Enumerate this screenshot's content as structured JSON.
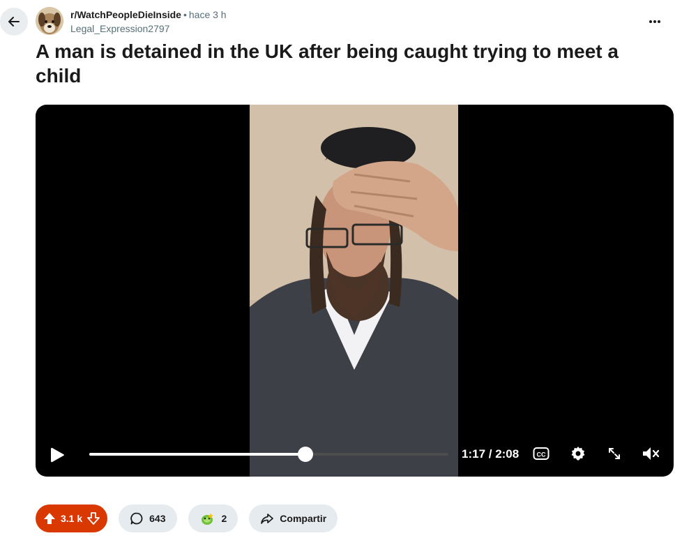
{
  "post": {
    "subreddit": "r/WatchPeopleDieInside",
    "separator": "•",
    "time_ago": "hace 3 h",
    "author": "Legal_Expression2797",
    "title": "A man is detained in the UK after being caught trying to meet a child"
  },
  "video": {
    "current_time": "1:17",
    "duration": "2:08",
    "time_readout": "1:17 / 2:08",
    "progress": 0.602,
    "muted": true,
    "cc_label": "CC"
  },
  "actions": {
    "votes": "3.1 k",
    "comments": "643",
    "awards": "2",
    "share_label": "Compartir"
  },
  "colors": {
    "accent": "#d93900",
    "pill_bg": "#e5ebee",
    "video_bg": "#000000"
  },
  "icons": [
    "back-arrow-icon",
    "more-options-icon",
    "play-icon",
    "captions-icon",
    "settings-gear-icon",
    "fullscreen-icon",
    "volume-muted-icon",
    "upvote-icon",
    "downvote-icon",
    "comment-icon",
    "award-icon",
    "share-icon"
  ]
}
